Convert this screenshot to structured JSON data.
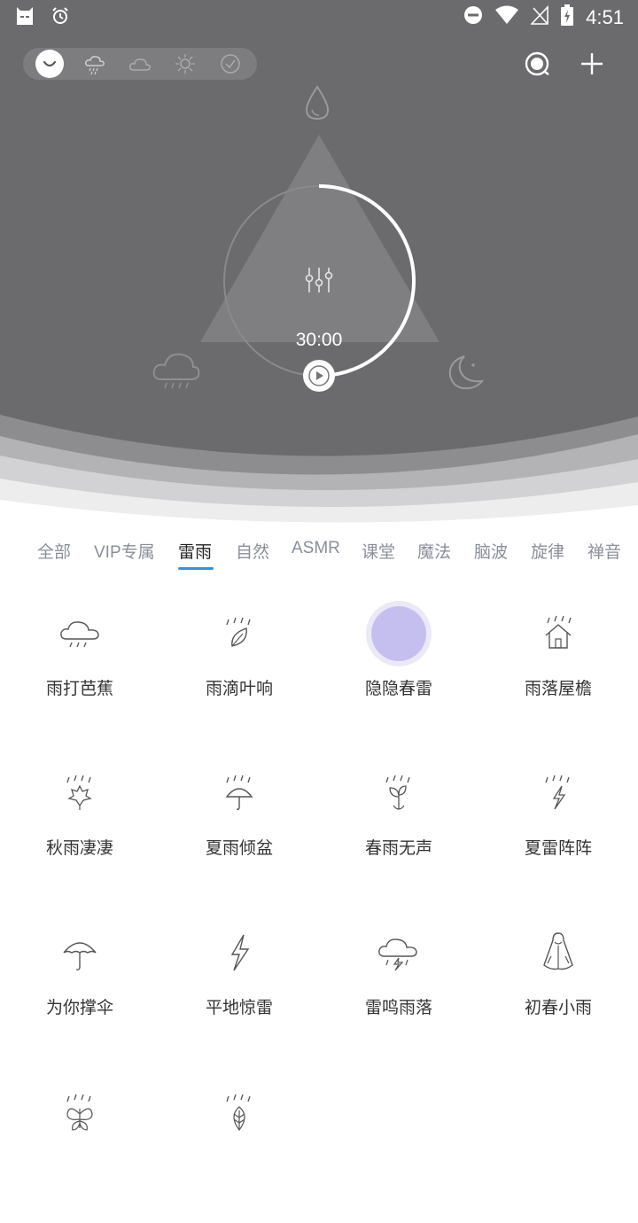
{
  "status_bar": {
    "time": "4:51"
  },
  "preset_bar": {
    "items": [
      "smile-icon",
      "rain-cloud-icon",
      "cloud-icon",
      "sun-icon",
      "check-circle-icon"
    ],
    "active_index": 0
  },
  "top_actions": [
    "timer-icon",
    "add-icon"
  ],
  "mixer": {
    "timer": "30:00",
    "top_sound": "water-drop-icon",
    "left_sound": "rain-cloud-icon",
    "right_sound": "moon-night-icon"
  },
  "tabs": {
    "items": [
      "全部",
      "VIP专属",
      "雷雨",
      "自然",
      "ASMR",
      "课堂",
      "魔法",
      "脑波",
      "旋律",
      "禅音"
    ],
    "active_index": 2,
    "accent": "#3a8fd9"
  },
  "sounds": [
    {
      "label": "雨打芭蕉",
      "icon": "rain-cloud-icon"
    },
    {
      "label": "雨滴叶响",
      "icon": "leaf-rain-icon"
    },
    {
      "label": "隐隐春雷",
      "icon": "selected-bubble",
      "selected": true
    },
    {
      "label": "雨落屋檐",
      "icon": "house-rain-icon"
    },
    {
      "label": "秋雨凄凄",
      "icon": "maple-rain-icon"
    },
    {
      "label": "夏雨倾盆",
      "icon": "umbrella-rain-icon"
    },
    {
      "label": "春雨无声",
      "icon": "sprout-rain-icon"
    },
    {
      "label": "夏雷阵阵",
      "icon": "lightning-rain-icon"
    },
    {
      "label": "为你撑伞",
      "icon": "umbrella-icon"
    },
    {
      "label": "平地惊雷",
      "icon": "lightning-icon"
    },
    {
      "label": "雷鸣雨落",
      "icon": "thunder-cloud-icon"
    },
    {
      "label": "初春小雨",
      "icon": "raincoat-icon"
    },
    {
      "label": "",
      "icon": "butterfly-rain-icon"
    },
    {
      "label": "",
      "icon": "leaf-rain-2-icon"
    }
  ]
}
